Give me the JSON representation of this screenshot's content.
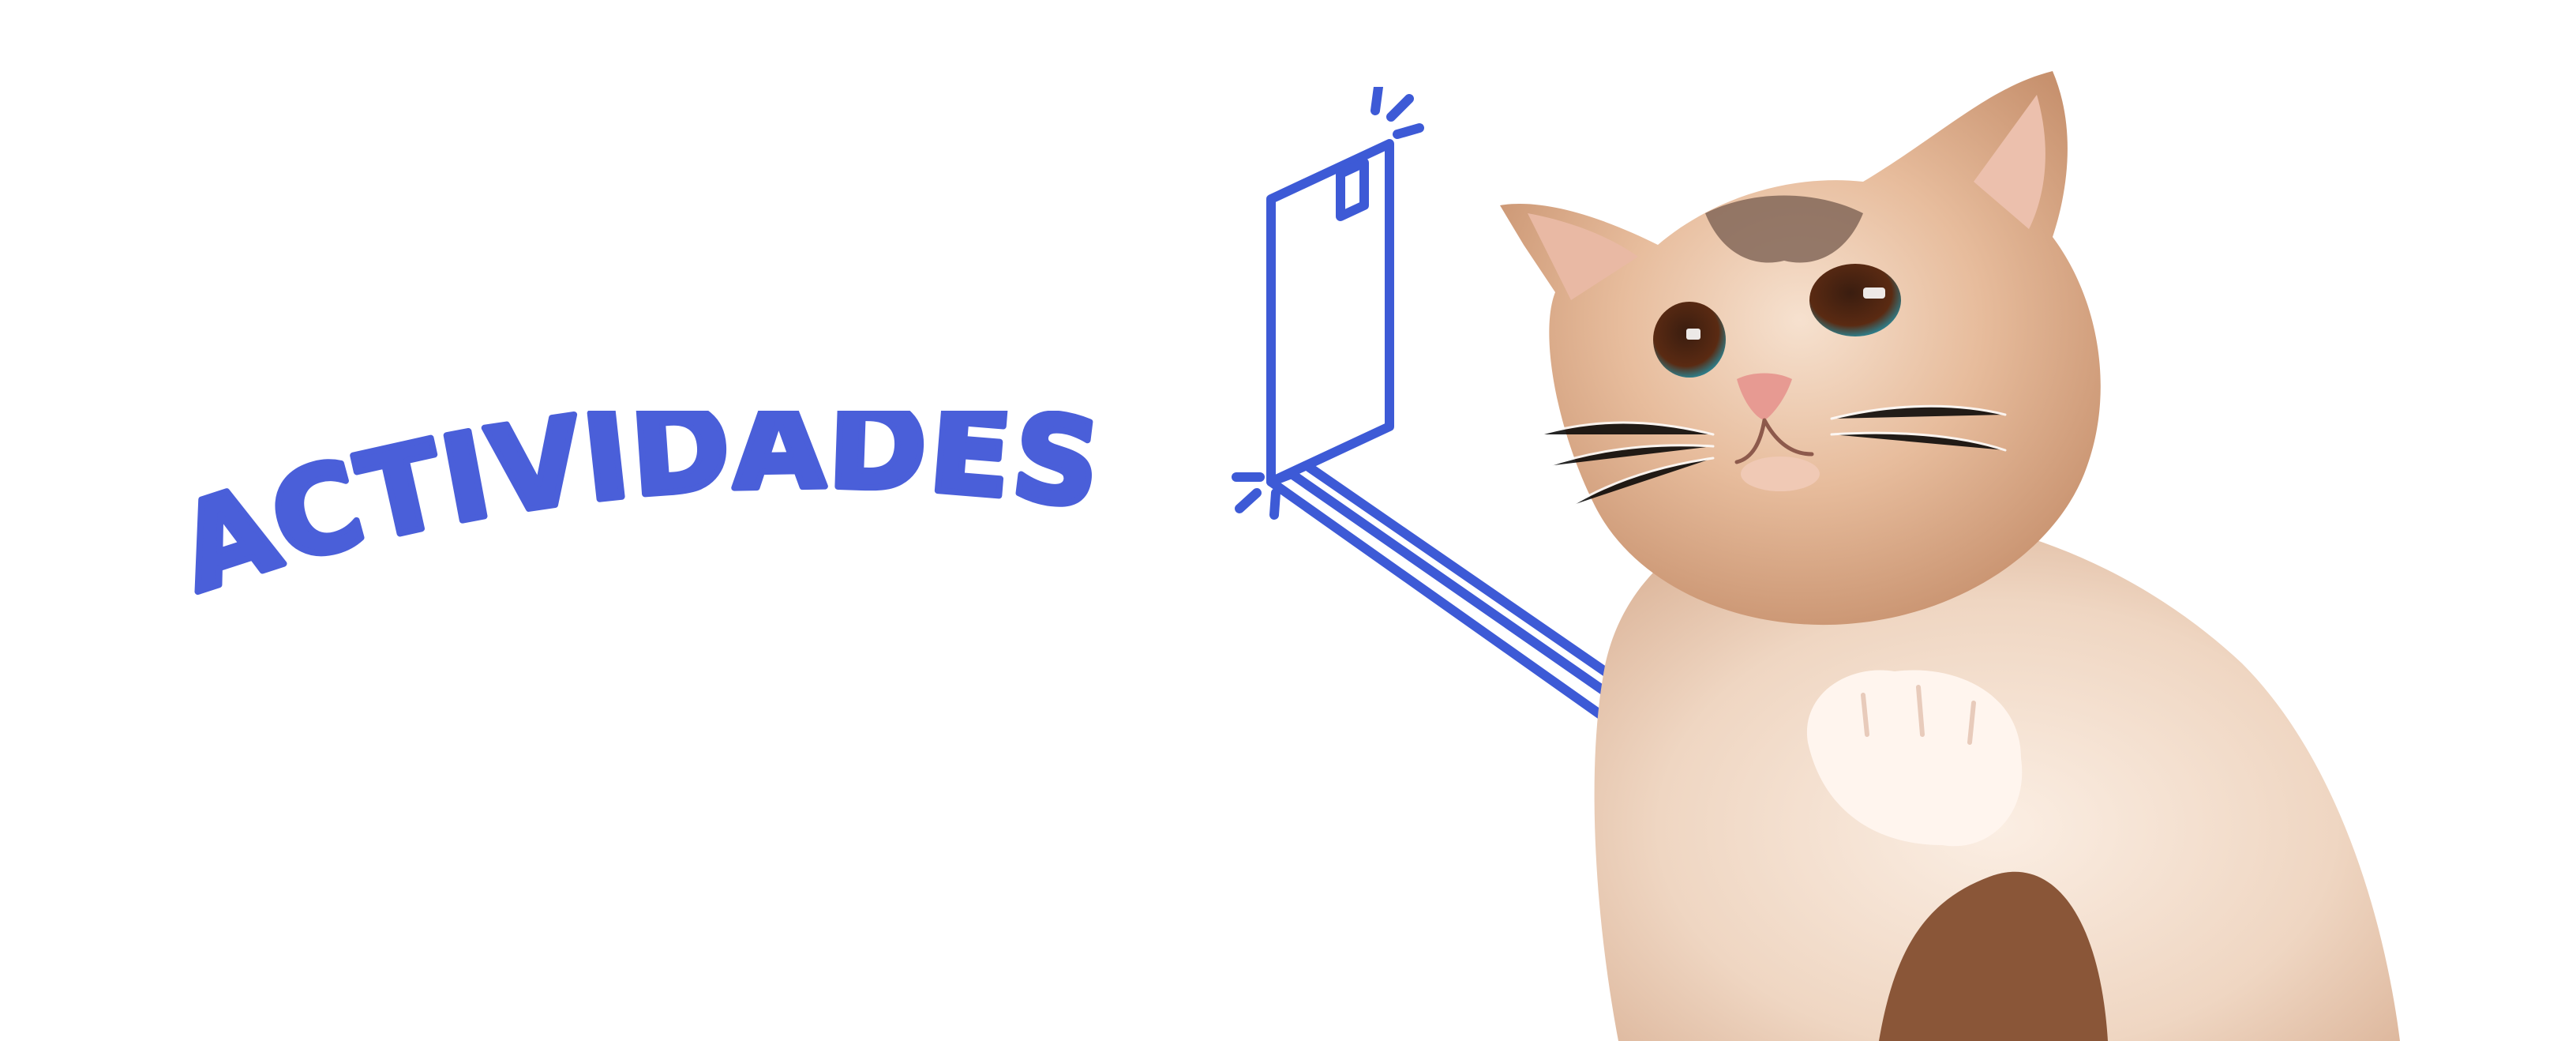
{
  "banner": {
    "title": "ACTIVIDADES",
    "accent_color": "#4a5fd9",
    "background_color": "#ffffff"
  },
  "illustration": {
    "selfie_stick_icon": "selfie-stick-icon",
    "phone_icon": "phone-icon",
    "camera_flash_icon": "flash-sparks-icon",
    "cat_photo": "cat-photo"
  }
}
